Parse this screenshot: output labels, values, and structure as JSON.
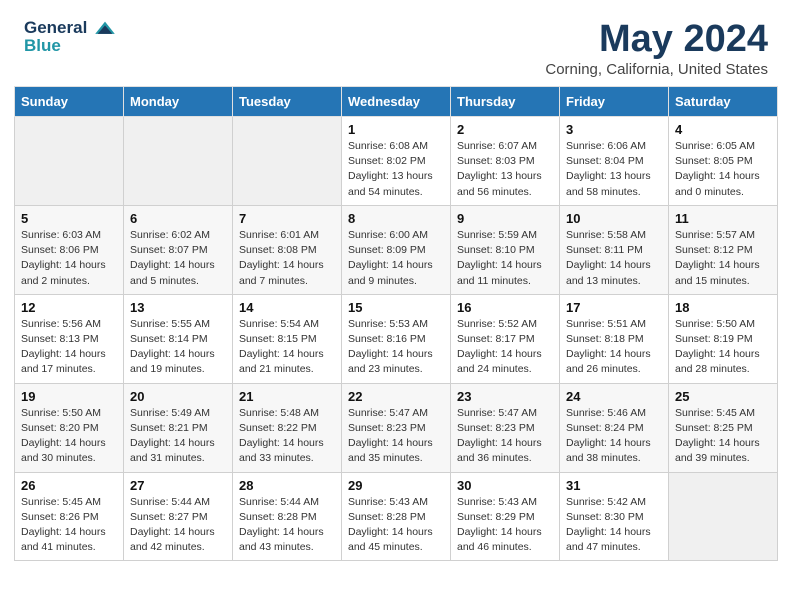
{
  "header": {
    "logo_line1": "General",
    "logo_line2": "Blue",
    "month_title": "May 2024",
    "location": "Corning, California, United States"
  },
  "days_of_week": [
    "Sunday",
    "Monday",
    "Tuesday",
    "Wednesday",
    "Thursday",
    "Friday",
    "Saturday"
  ],
  "weeks": [
    [
      {
        "num": "",
        "detail": ""
      },
      {
        "num": "",
        "detail": ""
      },
      {
        "num": "",
        "detail": ""
      },
      {
        "num": "1",
        "detail": "Sunrise: 6:08 AM\nSunset: 8:02 PM\nDaylight: 13 hours\nand 54 minutes."
      },
      {
        "num": "2",
        "detail": "Sunrise: 6:07 AM\nSunset: 8:03 PM\nDaylight: 13 hours\nand 56 minutes."
      },
      {
        "num": "3",
        "detail": "Sunrise: 6:06 AM\nSunset: 8:04 PM\nDaylight: 13 hours\nand 58 minutes."
      },
      {
        "num": "4",
        "detail": "Sunrise: 6:05 AM\nSunset: 8:05 PM\nDaylight: 14 hours\nand 0 minutes."
      }
    ],
    [
      {
        "num": "5",
        "detail": "Sunrise: 6:03 AM\nSunset: 8:06 PM\nDaylight: 14 hours\nand 2 minutes."
      },
      {
        "num": "6",
        "detail": "Sunrise: 6:02 AM\nSunset: 8:07 PM\nDaylight: 14 hours\nand 5 minutes."
      },
      {
        "num": "7",
        "detail": "Sunrise: 6:01 AM\nSunset: 8:08 PM\nDaylight: 14 hours\nand 7 minutes."
      },
      {
        "num": "8",
        "detail": "Sunrise: 6:00 AM\nSunset: 8:09 PM\nDaylight: 14 hours\nand 9 minutes."
      },
      {
        "num": "9",
        "detail": "Sunrise: 5:59 AM\nSunset: 8:10 PM\nDaylight: 14 hours\nand 11 minutes."
      },
      {
        "num": "10",
        "detail": "Sunrise: 5:58 AM\nSunset: 8:11 PM\nDaylight: 14 hours\nand 13 minutes."
      },
      {
        "num": "11",
        "detail": "Sunrise: 5:57 AM\nSunset: 8:12 PM\nDaylight: 14 hours\nand 15 minutes."
      }
    ],
    [
      {
        "num": "12",
        "detail": "Sunrise: 5:56 AM\nSunset: 8:13 PM\nDaylight: 14 hours\nand 17 minutes."
      },
      {
        "num": "13",
        "detail": "Sunrise: 5:55 AM\nSunset: 8:14 PM\nDaylight: 14 hours\nand 19 minutes."
      },
      {
        "num": "14",
        "detail": "Sunrise: 5:54 AM\nSunset: 8:15 PM\nDaylight: 14 hours\nand 21 minutes."
      },
      {
        "num": "15",
        "detail": "Sunrise: 5:53 AM\nSunset: 8:16 PM\nDaylight: 14 hours\nand 23 minutes."
      },
      {
        "num": "16",
        "detail": "Sunrise: 5:52 AM\nSunset: 8:17 PM\nDaylight: 14 hours\nand 24 minutes."
      },
      {
        "num": "17",
        "detail": "Sunrise: 5:51 AM\nSunset: 8:18 PM\nDaylight: 14 hours\nand 26 minutes."
      },
      {
        "num": "18",
        "detail": "Sunrise: 5:50 AM\nSunset: 8:19 PM\nDaylight: 14 hours\nand 28 minutes."
      }
    ],
    [
      {
        "num": "19",
        "detail": "Sunrise: 5:50 AM\nSunset: 8:20 PM\nDaylight: 14 hours\nand 30 minutes."
      },
      {
        "num": "20",
        "detail": "Sunrise: 5:49 AM\nSunset: 8:21 PM\nDaylight: 14 hours\nand 31 minutes."
      },
      {
        "num": "21",
        "detail": "Sunrise: 5:48 AM\nSunset: 8:22 PM\nDaylight: 14 hours\nand 33 minutes."
      },
      {
        "num": "22",
        "detail": "Sunrise: 5:47 AM\nSunset: 8:23 PM\nDaylight: 14 hours\nand 35 minutes."
      },
      {
        "num": "23",
        "detail": "Sunrise: 5:47 AM\nSunset: 8:23 PM\nDaylight: 14 hours\nand 36 minutes."
      },
      {
        "num": "24",
        "detail": "Sunrise: 5:46 AM\nSunset: 8:24 PM\nDaylight: 14 hours\nand 38 minutes."
      },
      {
        "num": "25",
        "detail": "Sunrise: 5:45 AM\nSunset: 8:25 PM\nDaylight: 14 hours\nand 39 minutes."
      }
    ],
    [
      {
        "num": "26",
        "detail": "Sunrise: 5:45 AM\nSunset: 8:26 PM\nDaylight: 14 hours\nand 41 minutes."
      },
      {
        "num": "27",
        "detail": "Sunrise: 5:44 AM\nSunset: 8:27 PM\nDaylight: 14 hours\nand 42 minutes."
      },
      {
        "num": "28",
        "detail": "Sunrise: 5:44 AM\nSunset: 8:28 PM\nDaylight: 14 hours\nand 43 minutes."
      },
      {
        "num": "29",
        "detail": "Sunrise: 5:43 AM\nSunset: 8:28 PM\nDaylight: 14 hours\nand 45 minutes."
      },
      {
        "num": "30",
        "detail": "Sunrise: 5:43 AM\nSunset: 8:29 PM\nDaylight: 14 hours\nand 46 minutes."
      },
      {
        "num": "31",
        "detail": "Sunrise: 5:42 AM\nSunset: 8:30 PM\nDaylight: 14 hours\nand 47 minutes."
      },
      {
        "num": "",
        "detail": ""
      }
    ]
  ]
}
